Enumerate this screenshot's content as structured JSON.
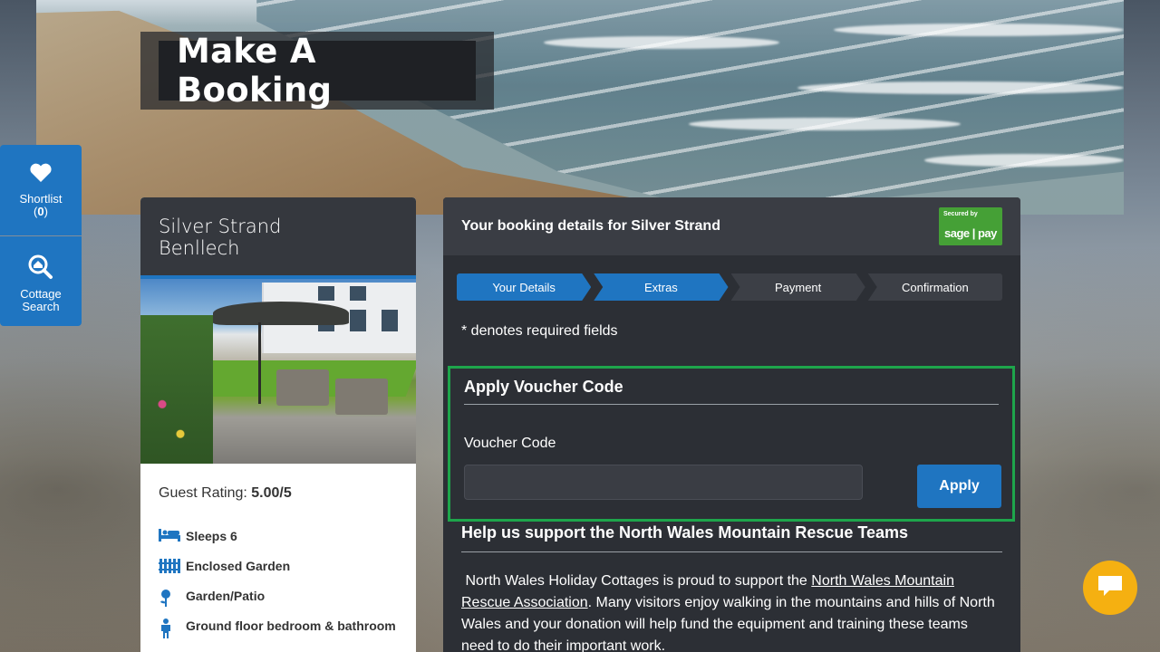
{
  "hero": {
    "title": "Make A Booking"
  },
  "side_tabs": {
    "shortlist": {
      "label": "Shortlist",
      "count": "0",
      "icon": "heart-icon"
    },
    "cottage_search": {
      "label_line1": "Cottage",
      "label_line2": "Search",
      "icon": "magnifier-house-icon"
    }
  },
  "property": {
    "name_line1": "Silver Strand",
    "name_line2": "Benllech",
    "rating_label": "Guest Rating:",
    "rating_value": "5.00/5",
    "features": [
      {
        "icon": "bed-icon",
        "label": "Sleeps 6"
      },
      {
        "icon": "fence-icon",
        "label": "Enclosed Garden"
      },
      {
        "icon": "flower-icon",
        "label": "Garden/Patio"
      },
      {
        "icon": "accessibility-icon",
        "label": "Ground floor bedroom & bathroom"
      }
    ]
  },
  "booking": {
    "header": "Your booking details for Silver Strand",
    "secure_badge": {
      "top": "Secured by",
      "brand": "sage | pay"
    },
    "steps": [
      "Your Details",
      "Extras",
      "Payment",
      "Confirmation"
    ],
    "active_steps": [
      0,
      1
    ],
    "required_note": "* denotes required fields",
    "voucher": {
      "heading": "Apply Voucher Code",
      "field_label": "Voucher Code",
      "field_value": "",
      "button": "Apply"
    },
    "help": {
      "heading": "Help us support the North Wales Mountain Rescue Teams",
      "text_before": " North Wales Holiday Cottages is proud to support the ",
      "link": "North Wales Mountain Rescue Association",
      "text_after": ". Many visitors enjoy walking in the mountains and hills of North Wales and your donation will help fund the equipment and training these teams need to do their important work."
    }
  },
  "colors": {
    "brand_blue": "#1f75c1",
    "voucher_border": "#1ea54b",
    "chat": "#f5b011",
    "panel": "#2c2f35"
  }
}
